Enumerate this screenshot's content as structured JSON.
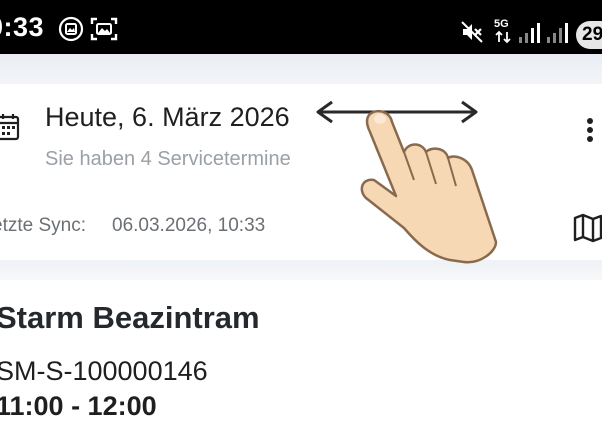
{
  "status_bar": {
    "time": "0:33",
    "network": "5G",
    "battery": "29",
    "icons": [
      "media-icon",
      "screenshot-icon",
      "mute-icon",
      "network-5g-icon",
      "signal-icon",
      "signal-icon"
    ]
  },
  "header": {
    "date_title": "Heute, 6. März 2026",
    "subtitle": "Sie haben 4 Servicetermine",
    "sync_label": "etzte Sync:",
    "sync_value": "06.03.2026, 10:33"
  },
  "appointment": {
    "name": "Starm Beazintram",
    "id": "SM-S-100000146",
    "time": "11:00 - 12:00"
  },
  "colors": {
    "status_bar_bg": "#000000",
    "band_bg": "#e9edf3",
    "title_text": "#1f1f1f",
    "muted_text": "#9aa0a6"
  }
}
